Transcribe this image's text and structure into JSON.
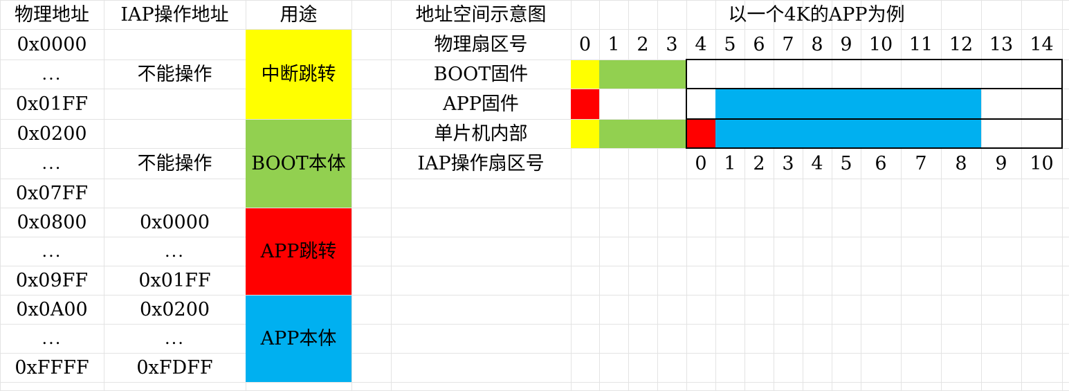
{
  "headers": {
    "physical": "物理地址",
    "iap": "IAP操作地址",
    "usage": "用途",
    "diagram": "地址空间示意图",
    "example": "以一个4K的APP为例"
  },
  "rows_left": {
    "phys": [
      "0x0000",
      "...",
      "0x01FF",
      "0x0200",
      "...",
      "0x07FF",
      "0x0800",
      "...",
      "0x09FF",
      "0x0A00",
      "...",
      "0xFFFF"
    ],
    "iap_blocks": [
      {
        "text": "不能操作"
      },
      {
        "text": "不能操作"
      },
      {
        "lines": [
          "0x0000",
          "...",
          "0x01FF"
        ]
      },
      {
        "lines": [
          "0x0200",
          "...",
          "0xFDFF"
        ]
      }
    ],
    "usage_blocks": [
      {
        "label": "中断跳转",
        "color": "#FFFF00"
      },
      {
        "label": "BOOT本体",
        "color": "#92D050"
      },
      {
        "label": "APP跳转",
        "color": "#FF0000"
      },
      {
        "label": "APP本体",
        "color": "#00B0F0"
      }
    ]
  },
  "diagram": {
    "labels": {
      "physical_sector": "物理扇区号",
      "boot_firmware": "BOOT固件",
      "app_firmware": "APP固件",
      "mcu_internal": "单片机内部",
      "iap_sector": "IAP操作扇区号"
    },
    "physical_sectors": [
      "0",
      "1",
      "2",
      "3",
      "4",
      "5",
      "6",
      "7",
      "8",
      "9",
      "10",
      "11",
      "12",
      "13",
      "14"
    ],
    "iap_sectors": [
      "0",
      "1",
      "2",
      "3",
      "4",
      "5",
      "6",
      "7",
      "8",
      "9",
      "10"
    ],
    "colors": {
      "yellow": "#FFFF00",
      "green": "#92D050",
      "red": "#FF0000",
      "blue": "#00B0F0"
    }
  }
}
